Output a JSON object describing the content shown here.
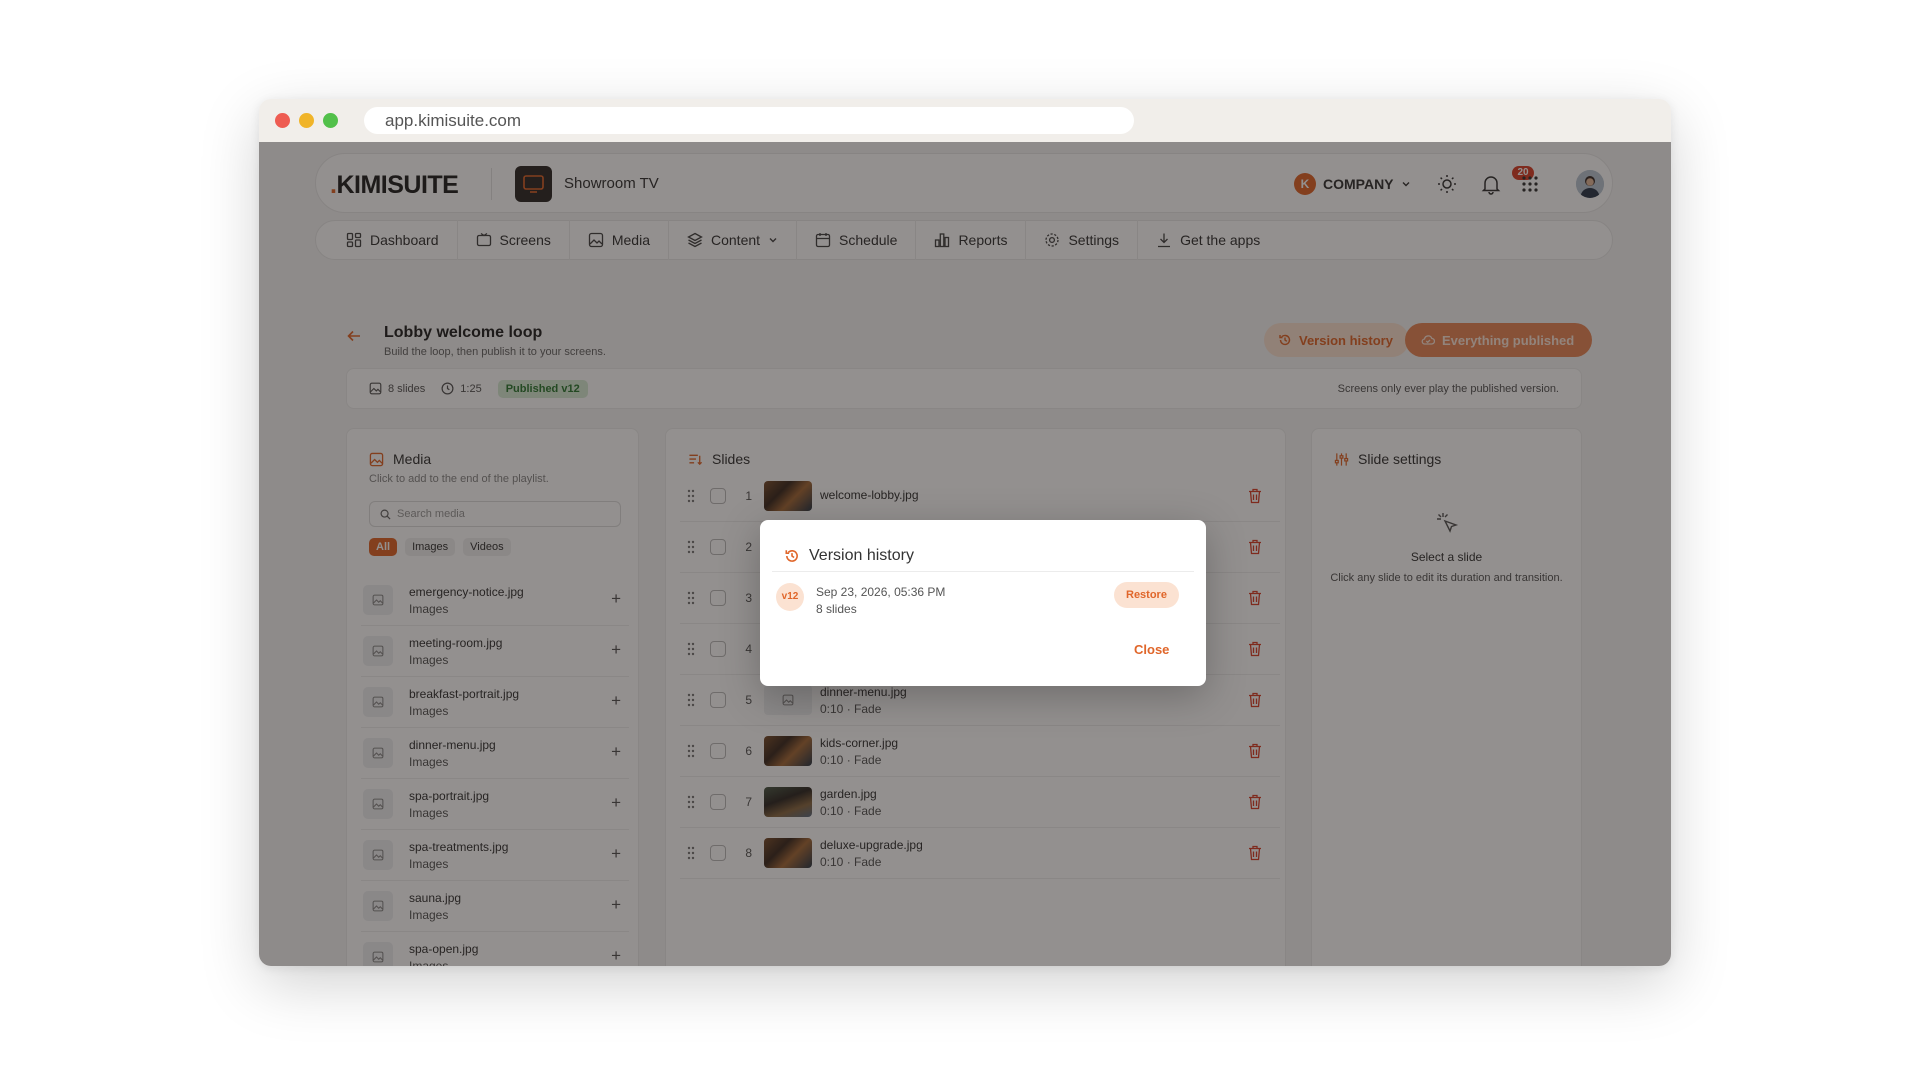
{
  "browser": {
    "url": "app.kimisuite.com"
  },
  "header": {
    "logo_dot": ".",
    "logo_text": "KIMISUITE",
    "screen_name": "Showroom TV",
    "company_initial": "K",
    "company_label": "COMPANY",
    "notification_count": "20"
  },
  "nav": {
    "items": [
      {
        "label": "Dashboard",
        "icon": "grid-icon"
      },
      {
        "label": "Screens",
        "icon": "tv-icon"
      },
      {
        "label": "Media",
        "icon": "image-icon"
      },
      {
        "label": "Content",
        "icon": "layers-icon"
      },
      {
        "label": "Schedule",
        "icon": "calendar-icon"
      },
      {
        "label": "Reports",
        "icon": "bar-chart-icon"
      },
      {
        "label": "Settings",
        "icon": "gear-icon"
      },
      {
        "label": "Get the apps",
        "icon": "download-icon"
      }
    ]
  },
  "page": {
    "title": "Lobby welcome loop",
    "subtitle": "Build the loop, then publish it to your screens.",
    "version_history_label": "Version history",
    "publish_label": "Everything published"
  },
  "info": {
    "slides": "8 slides",
    "duration": "1:25",
    "published": "Published v12",
    "note": "Screens only ever play the published version."
  },
  "media": {
    "title": "Media",
    "hint": "Click to add to the end of the playlist.",
    "search_placeholder": "Search media",
    "filters": [
      "All",
      "Images",
      "Videos"
    ],
    "items": [
      {
        "name": "emergency-notice.jpg",
        "type": "Images"
      },
      {
        "name": "meeting-room.jpg",
        "type": "Images"
      },
      {
        "name": "breakfast-portrait.jpg",
        "type": "Images"
      },
      {
        "name": "dinner-menu.jpg",
        "type": "Images"
      },
      {
        "name": "spa-portrait.jpg",
        "type": "Images"
      },
      {
        "name": "spa-treatments.jpg",
        "type": "Images"
      },
      {
        "name": "sauna.jpg",
        "type": "Images"
      },
      {
        "name": "spa-open.jpg",
        "type": "Images"
      }
    ]
  },
  "slides": {
    "title": "Slides",
    "items": [
      {
        "num": "1",
        "name": "welcome-lobby.jpg",
        "meta": ""
      },
      {
        "num": "2",
        "name": "",
        "meta": ""
      },
      {
        "num": "3",
        "name": "",
        "meta": ""
      },
      {
        "num": "4",
        "name": "",
        "meta": ""
      },
      {
        "num": "5",
        "name": "dinner-menu.jpg",
        "meta": "0:10 · Fade"
      },
      {
        "num": "6",
        "name": "kids-corner.jpg",
        "meta": "0:10 · Fade"
      },
      {
        "num": "7",
        "name": "garden.jpg",
        "meta": "0:10 · Fade"
      },
      {
        "num": "8",
        "name": "deluxe-upgrade.jpg",
        "meta": "0:10 · Fade"
      }
    ]
  },
  "settings": {
    "title": "Slide settings",
    "empty_title": "Select a slide",
    "empty_sub": "Click any slide to edit its duration and transition."
  },
  "modal": {
    "title": "Version history",
    "version": "v12",
    "date": "Sep 23, 2026, 05:36 PM",
    "slides": "8 slides",
    "restore_label": "Restore",
    "close_label": "Close"
  }
}
